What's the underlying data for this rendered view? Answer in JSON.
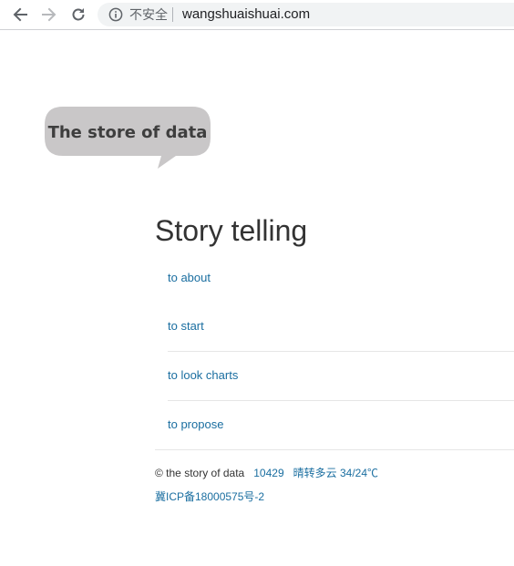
{
  "browser": {
    "security_label": "不安全",
    "url": "wangshuaishuai.com"
  },
  "logo": {
    "text": "The store of data"
  },
  "main": {
    "heading": "Story telling",
    "links": [
      {
        "label": "to about"
      },
      {
        "label": "to start"
      },
      {
        "label": "to look charts"
      },
      {
        "label": "to propose"
      }
    ]
  },
  "footer": {
    "copyright": "© the story of data",
    "visits": "10429",
    "weather": "晴转多云 34/24℃",
    "icp": "冀ICP备18000575号-2"
  },
  "colors": {
    "link": "#1a6ea0",
    "heading": "#333333",
    "logo_bubble": "#c9c7c8",
    "logo_text": "#3e3e3e"
  }
}
